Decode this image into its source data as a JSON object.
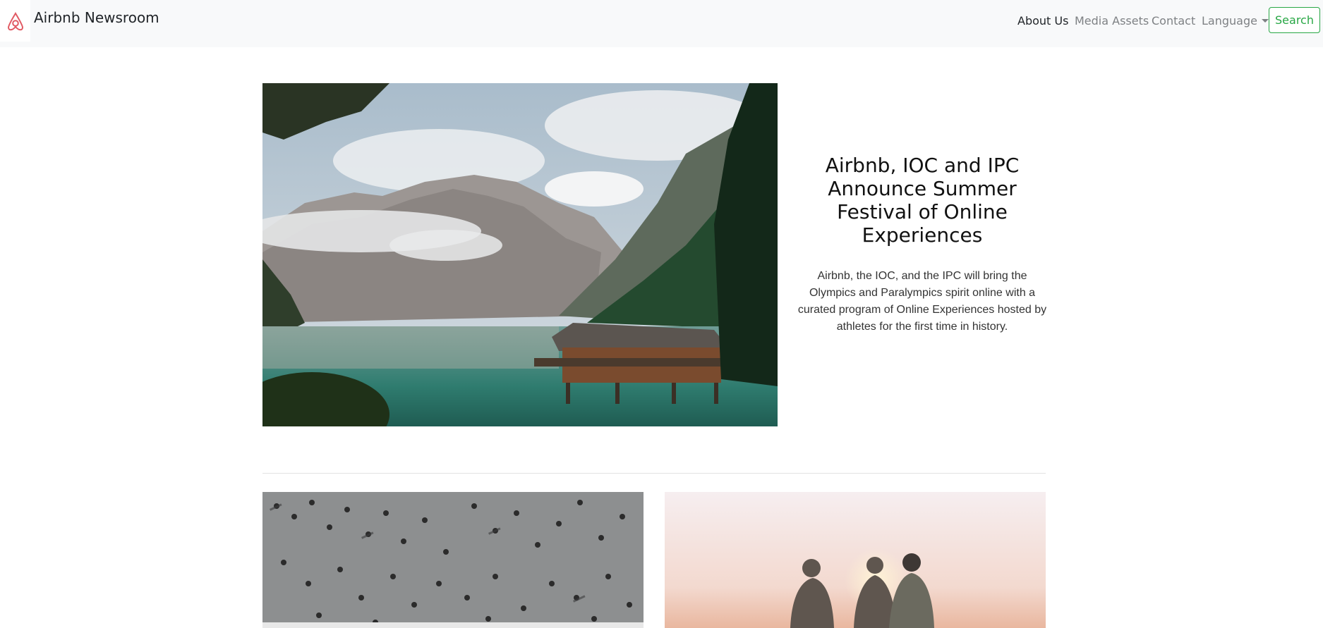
{
  "navbar": {
    "brand": "Airbnb Newsroom",
    "logo_icon": "airbnb-logo-icon",
    "links": [
      {
        "label": "About Us",
        "active": true
      },
      {
        "label": "Media Assets",
        "active": false
      },
      {
        "label": "Contact",
        "active": false
      },
      {
        "label": "Language",
        "active": false,
        "dropdown": true
      }
    ],
    "search_label": "Search",
    "colors": {
      "brand": "#ff5a5f",
      "search": "#28a745",
      "bar_bg": "#f8f9fa"
    }
  },
  "hero": {
    "image": "mountain-lake-cabin-photo",
    "title": "Airbnb, IOC and IPC Announce Summer Festival of Online Experiences",
    "description": "Airbnb, the IOC, and the IPC will bring the Olympics and Paralympics spirit online with a curated program of Online Experiences hosted by athletes for the first time in history."
  },
  "cards": [
    {
      "image": "crowd-crossing-street-photo"
    },
    {
      "image": "friends-hugging-sunset-photo"
    }
  ]
}
